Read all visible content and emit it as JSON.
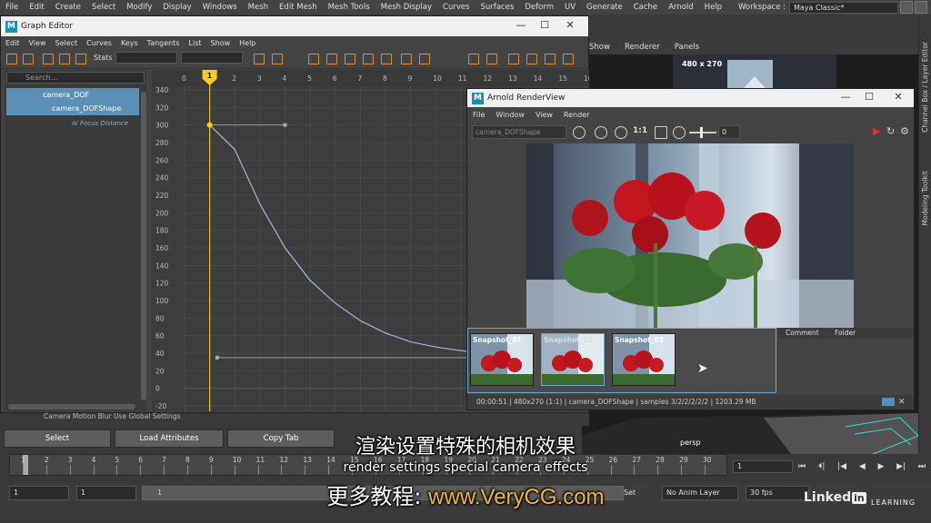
{
  "maya": {
    "menu": [
      "File",
      "Edit",
      "Create",
      "Select",
      "Modify",
      "Display",
      "Windows",
      "Mesh",
      "Edit Mesh",
      "Mesh Tools",
      "Mesh Display",
      "Curves",
      "Surfaces",
      "Deform",
      "UV",
      "Generate",
      "Cache",
      "Arnold",
      "Help"
    ],
    "workspace_label": "Workspace :",
    "workspace_value": "Maya Classic*",
    "right_menu": [
      "Show",
      "Renderer",
      "Panels"
    ],
    "side_tabs": [
      "Channel Box / Layer Editor",
      "Modeling Toolkit"
    ],
    "viewport_resolution": "480 x 270",
    "viewport_camera": "persp"
  },
  "graph_editor": {
    "title": "Graph Editor",
    "menu": [
      "Edit",
      "View",
      "Select",
      "Curves",
      "Keys",
      "Tangents",
      "List",
      "Show",
      "Help"
    ],
    "stats_label": "Stats",
    "search_placeholder": "Search...",
    "outliner": [
      {
        "label": "camera_DOF"
      },
      {
        "label": "camera_DOFShape"
      },
      {
        "label": "Ai Focus Distance"
      }
    ],
    "frame_ticks": [
      "0",
      "1",
      "2",
      "3",
      "4",
      "5",
      "6",
      "7",
      "8",
      "9",
      "10",
      "11",
      "12",
      "13",
      "14",
      "15",
      "16"
    ],
    "current_frame_marker": "1",
    "value_ticks": [
      "340",
      "320",
      "300",
      "280",
      "260",
      "240",
      "220",
      "200",
      "180",
      "160",
      "140",
      "120",
      "100",
      "80",
      "60",
      "40",
      "20",
      "0",
      "-20"
    ]
  },
  "chart_data": {
    "type": "line",
    "title": "",
    "xlabel": "",
    "ylabel": "",
    "xlim": [
      0,
      16
    ],
    "ylim": [
      -20,
      340
    ],
    "series": [
      {
        "x": [
          1,
          2,
          3,
          4,
          5,
          6,
          7,
          8,
          9,
          10,
          11,
          12,
          13,
          14,
          15,
          16
        ],
        "y": [
          300,
          272,
          210,
          160,
          123,
          97,
          77,
          63,
          53,
          47,
          43,
          40,
          38,
          37,
          36,
          35
        ]
      }
    ]
  },
  "attr_editor": {
    "row_text": "Camera Motion Blur    Use Global Settings",
    "buttons": [
      "Select",
      "Load Attributes",
      "Copy Tab"
    ]
  },
  "render_view": {
    "title": "Arnold RenderView",
    "menu": [
      "File",
      "Window",
      "View",
      "Render"
    ],
    "camera": "camera_DOFShape",
    "ratio": "1:1",
    "exposure": "0",
    "snapshots": [
      "Snapshot_01",
      "Snapshot_02",
      "Snapshot_03"
    ],
    "tabs": [
      "Comment",
      "Folder"
    ],
    "status": "00:00:51 | 480x270 (1:1) | camera_DOFShape | samples 3/2/2/2/2/2 | 1203.29 MB"
  },
  "timeline": {
    "ticks": [
      "1",
      "2",
      "3",
      "4",
      "5",
      "6",
      "7",
      "8",
      "9",
      "10",
      "11",
      "12",
      "13",
      "14",
      "15",
      "16",
      "17",
      "18",
      "19",
      "20",
      "21",
      "22",
      "23",
      "24",
      "25",
      "26",
      "27",
      "28",
      "29",
      "30"
    ],
    "current_frame": "1",
    "start_field": "1",
    "start_field2": "1",
    "range_slider": "1",
    "anim_layer": "No Anim Layer",
    "fps": "30 fps",
    "set_label": "Set"
  },
  "branding": {
    "linkedin": "Linked",
    "linkedin_in": "in",
    "learning": "LEARNING"
  },
  "subtitles": {
    "cn": "渲染设置特殊的相机效果",
    "en": "render settings special camera effects",
    "url_prefix": "更多教程:",
    "url": "www.VeryCG.com"
  }
}
